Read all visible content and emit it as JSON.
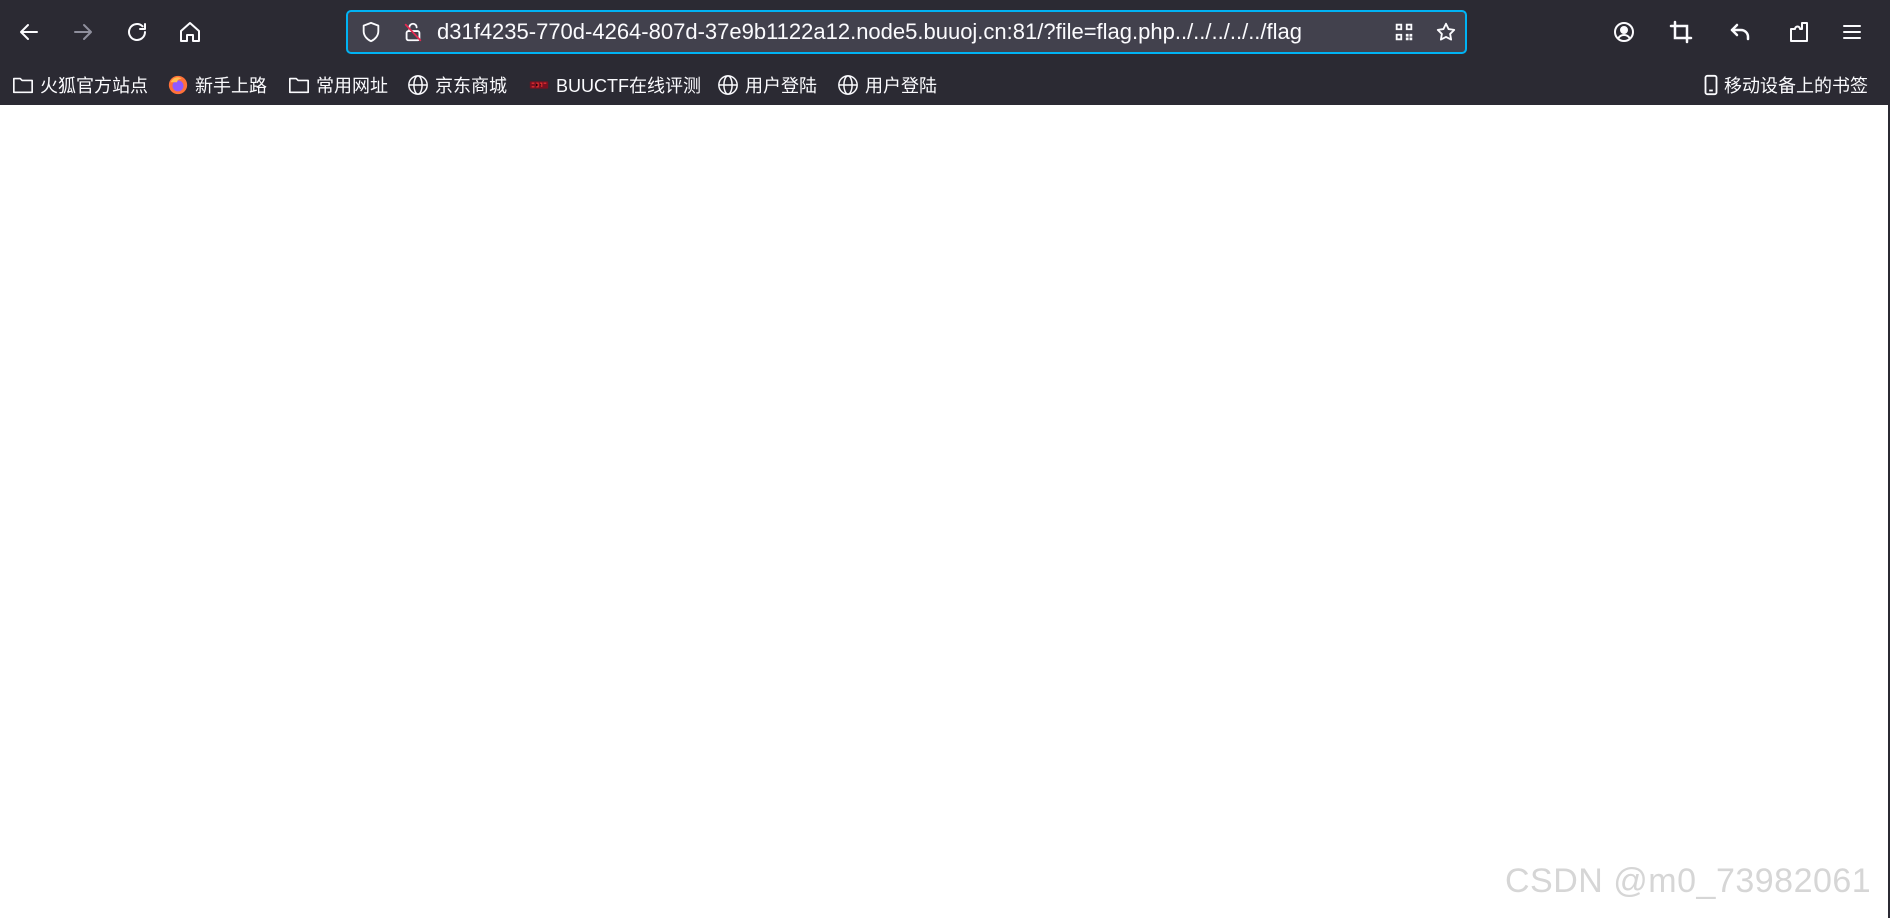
{
  "toolbar": {
    "url": "d31f4235-770d-4264-807d-37e9b1122a12.node5.buuoj.cn:81/?file=flag.php../../../../../flag"
  },
  "bookmarks": [
    {
      "label": "火狐官方站点",
      "icon": "folder-icon"
    },
    {
      "label": "新手上路",
      "icon": "firefox-icon"
    },
    {
      "label": "常用网址",
      "icon": "folder-icon"
    },
    {
      "label": "京东商城",
      "icon": "globe-icon"
    },
    {
      "label": "BUUCTF在线评测",
      "icon": "buuctf-favicon"
    },
    {
      "label": "用户登陆",
      "icon": "globe-icon"
    },
    {
      "label": "用户登陆",
      "icon": "globe-icon"
    }
  ],
  "mobile_bookmarks": {
    "label": "移动设备上的书签",
    "icon": "mobile-icon"
  },
  "watermark": "CSDN @m0_73982061",
  "colors": {
    "chrome_bg": "#2b2a33",
    "urlbar_bg": "#42414d",
    "urlbar_focus": "#00b3f4",
    "text": "#fbfbfe"
  }
}
